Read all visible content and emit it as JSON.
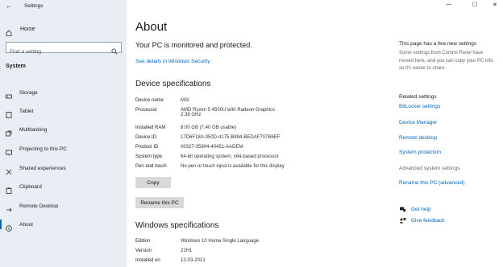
{
  "window": {
    "title": "Settings",
    "minimize": "—",
    "maximize": "☐",
    "close": "✕"
  },
  "sidebar": {
    "home_label": "Home",
    "search_placeholder": "Find a setting",
    "section_label": "System",
    "items": [
      {
        "label": "Storage",
        "icon": "storage-icon"
      },
      {
        "label": "Tablet",
        "icon": "tablet-icon"
      },
      {
        "label": "Multitasking",
        "icon": "multitasking-icon"
      },
      {
        "label": "Projecting to this PC",
        "icon": "projecting-icon"
      },
      {
        "label": "Shared experiences",
        "icon": "shared-experiences-icon"
      },
      {
        "label": "Clipboard",
        "icon": "clipboard-icon"
      },
      {
        "label": "Remote Desktop",
        "icon": "remote-desktop-icon"
      },
      {
        "label": "About",
        "icon": "info-icon",
        "active": true
      }
    ]
  },
  "main": {
    "title": "About",
    "protection_message": "Your PC is monitored and protected.",
    "security_link": "See details in Windows Security",
    "device_specs": {
      "heading": "Device specifications",
      "rows": [
        {
          "key": "Device name",
          "value": "MSI"
        },
        {
          "key": "Processor",
          "value": "AMD Ryzen 5 4500U with Radeon Graphics",
          "value2": "2.38 GHz"
        },
        {
          "key": "Installed RAM",
          "value": "8.00 GB (7.40 GB usable)"
        },
        {
          "key": "Device ID",
          "value": "17D6F18A-050D-4175-B894-BEDAF707B6EF"
        },
        {
          "key": "Product ID",
          "value": "00327-35904-40451-AADEM"
        },
        {
          "key": "System type",
          "value": "64-bit operating system, x64-based processor"
        },
        {
          "key": "Pen and touch",
          "value": "No pen or touch input is available for this display"
        }
      ],
      "copy_button": "Copy",
      "rename_button": "Rename this PC"
    },
    "windows_specs": {
      "heading": "Windows specifications",
      "rows": [
        {
          "key": "Edition",
          "value": "Windows 10 Home Single Language"
        },
        {
          "key": "Version",
          "value": "21H1"
        },
        {
          "key": "Installed on",
          "value": "12-03-2021"
        }
      ]
    }
  },
  "right": {
    "new_settings_heading": "This page has a few new settings",
    "new_settings_text": "Some settings from Control Panel have moved here, and you can copy your PC info so it's easier to share.",
    "related_heading": "Related settings",
    "links": [
      {
        "label": "BitLocker settings",
        "enabled": true
      },
      {
        "label": "Device Manager",
        "enabled": true
      },
      {
        "label": "Remote desktop",
        "enabled": true
      },
      {
        "label": "System protection",
        "enabled": true
      },
      {
        "label": "Advanced system settings",
        "enabled": false
      },
      {
        "label": "Rename this PC (advanced)",
        "enabled": true
      }
    ],
    "get_help": "Get help",
    "give_feedback": "Give feedback"
  },
  "colors": {
    "sidebar_bg": "#e9eef5",
    "accent": "#0067c0",
    "button_bg": "#d9d9d9"
  }
}
